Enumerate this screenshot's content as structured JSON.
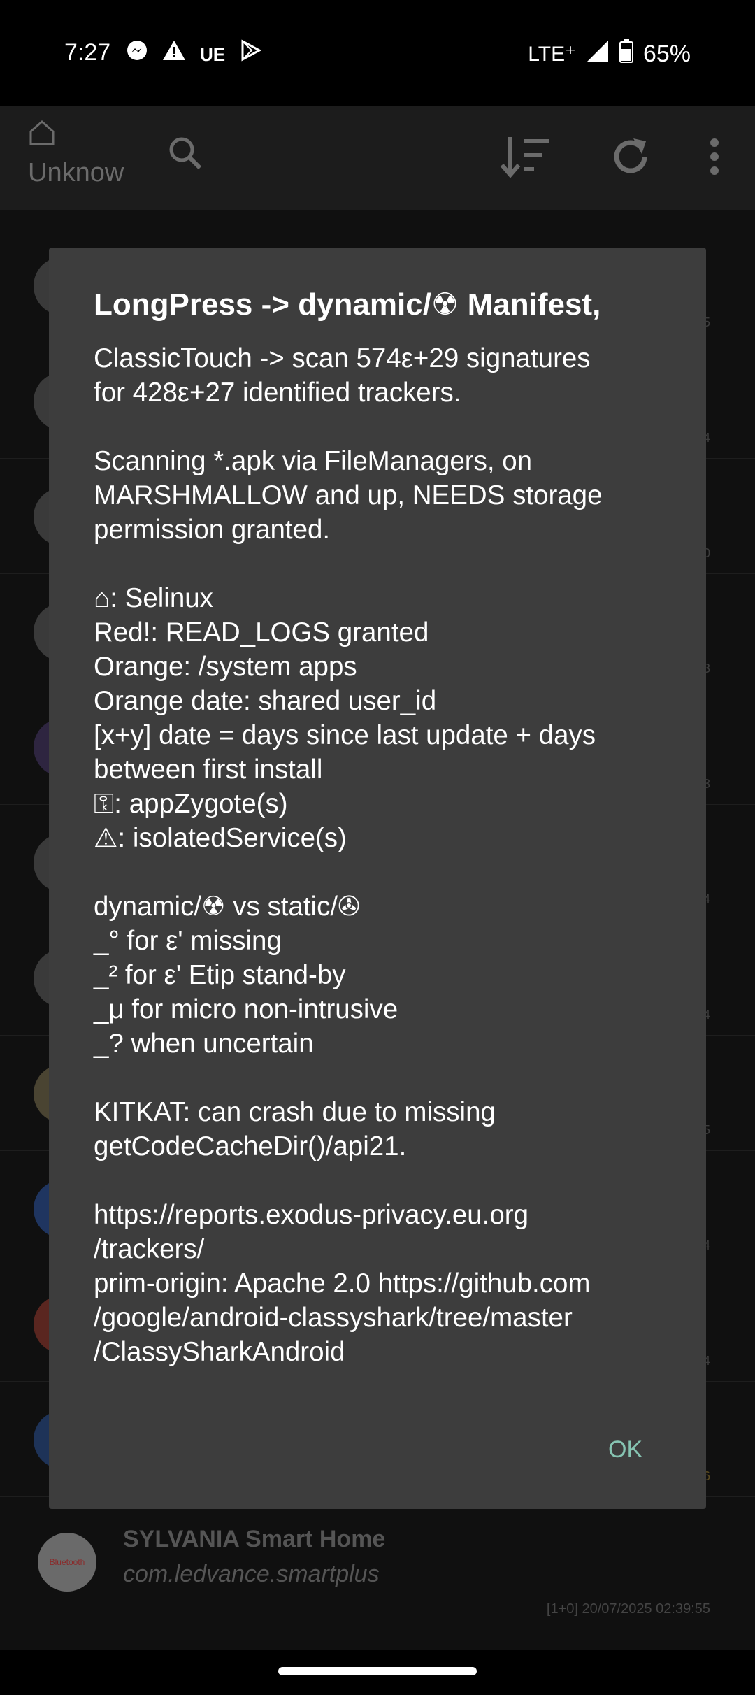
{
  "status_bar": {
    "time": "7:27",
    "left_icons": [
      "messenger-icon",
      "warning-icon",
      "ue-icon",
      "play-icon"
    ],
    "ue_text": "UE",
    "network": "LTE⁺",
    "battery": "65%"
  },
  "toolbar": {
    "home_label": "Unknow",
    "icons": [
      "home-icon",
      "search-icon",
      "sort-icon",
      "refresh-icon",
      "more-icon"
    ]
  },
  "background_rows": [
    {
      "num": "5"
    },
    {
      "num": "4"
    },
    {
      "num": "0"
    },
    {
      "num": "3"
    },
    {
      "num": "8"
    },
    {
      "num": "4"
    },
    {
      "num": "4"
    },
    {
      "num": "5"
    },
    {
      "num": "4"
    },
    {
      "num": "4"
    },
    {
      "num": "6"
    }
  ],
  "last_row": {
    "title": "SYLVANIA Smart Home",
    "package": "com.ledvance.smartplus",
    "meta": "[1+0]    20/07/2025 02:39:55",
    "logo_text": "Bluetooth"
  },
  "dialog": {
    "title": "LongPress -> dynamic/☢ Manifest,",
    "body_lines": [
      "ClassicTouch -> scan 574ε+29 signatures",
      "for 428ε+27 identified trackers.",
      "",
      "Scanning *.apk via FileManagers, on",
      "MARSHMALLOW and up, NEEDS storage",
      "permission granted.",
      "",
      "⌂: Selinux",
      "Red!: READ_LOGS granted",
      "Orange: /system apps",
      "Orange date: shared user_id",
      "[x+y] date = days since last update + days",
      "between first install",
      "⚿: appZygote(s)",
      "⚠: isolatedService(s)",
      "",
      "dynamic/☢ vs static/✇",
      "_° for ε' missing",
      "_² for ε' Etip stand-by",
      "_μ for micro non-intrusive",
      "_? when uncertain",
      "",
      "KITKAT: can crash due to missing",
      "getCodeCacheDir()/api21.",
      "",
      "https://reports.exodus-privacy.eu.org",
      "/trackers/",
      "prim-origin: Apache 2.0 https://github.com",
      "/google/android-classyshark/tree/master",
      "/ClassySharkAndroid"
    ],
    "ok_label": "OK"
  }
}
